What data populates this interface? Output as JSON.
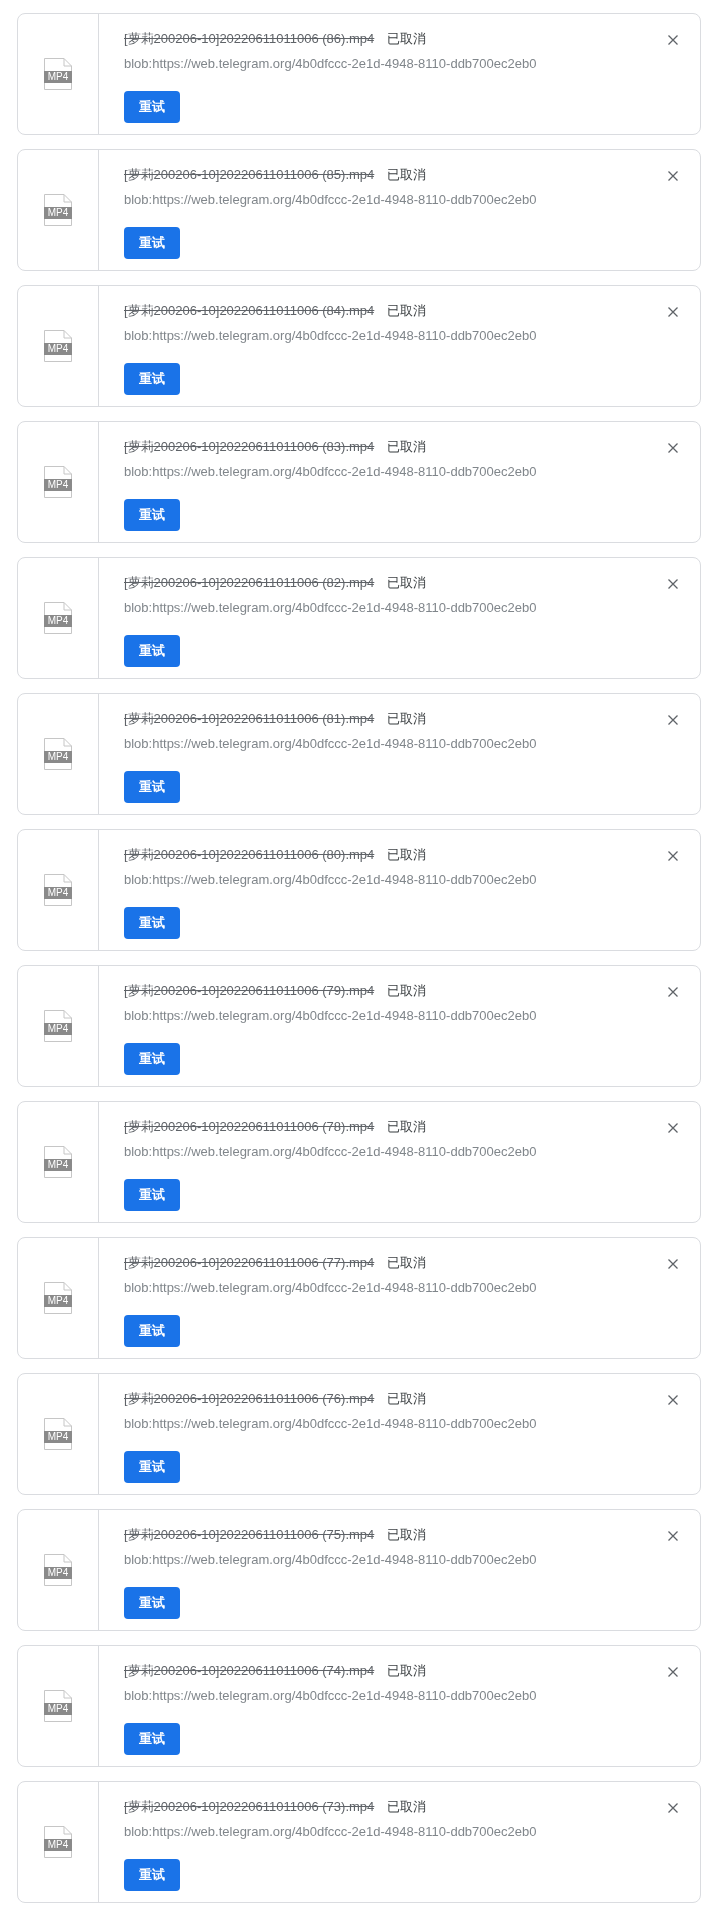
{
  "downloads": [
    {
      "file_type": "MP4",
      "filename": "[萝莉200206-10]20220611011006 (86).mp4",
      "cancelled": true,
      "status": "已取消",
      "url": "blob:https://web.telegram.org/4b0dfccc-2e1d-4948-8110-ddb700ec2eb0",
      "button": "重试"
    },
    {
      "file_type": "MP4",
      "filename": "[萝莉200206-10]20220611011006 (85).mp4",
      "cancelled": true,
      "status": "已取消",
      "url": "blob:https://web.telegram.org/4b0dfccc-2e1d-4948-8110-ddb700ec2eb0",
      "button": "重试"
    },
    {
      "file_type": "MP4",
      "filename": "[萝莉200206-10]20220611011006 (84).mp4",
      "cancelled": true,
      "status": "已取消",
      "url": "blob:https://web.telegram.org/4b0dfccc-2e1d-4948-8110-ddb700ec2eb0",
      "button": "重试"
    },
    {
      "file_type": "MP4",
      "filename": "[萝莉200206-10]20220611011006 (83).mp4",
      "cancelled": true,
      "status": "已取消",
      "url": "blob:https://web.telegram.org/4b0dfccc-2e1d-4948-8110-ddb700ec2eb0",
      "button": "重试"
    },
    {
      "file_type": "MP4",
      "filename": "[萝莉200206-10]20220611011006 (82).mp4",
      "cancelled": true,
      "status": "已取消",
      "url": "blob:https://web.telegram.org/4b0dfccc-2e1d-4948-8110-ddb700ec2eb0",
      "button": "重试"
    },
    {
      "file_type": "MP4",
      "filename": "[萝莉200206-10]20220611011006 (81).mp4",
      "cancelled": true,
      "status": "已取消",
      "url": "blob:https://web.telegram.org/4b0dfccc-2e1d-4948-8110-ddb700ec2eb0",
      "button": "重试"
    },
    {
      "file_type": "MP4",
      "filename": "[萝莉200206-10]20220611011006 (80).mp4",
      "cancelled": true,
      "status": "已取消",
      "url": "blob:https://web.telegram.org/4b0dfccc-2e1d-4948-8110-ddb700ec2eb0",
      "button": "重试"
    },
    {
      "file_type": "MP4",
      "filename": "[萝莉200206-10]20220611011006 (79).mp4",
      "cancelled": true,
      "status": "已取消",
      "url": "blob:https://web.telegram.org/4b0dfccc-2e1d-4948-8110-ddb700ec2eb0",
      "button": "重试"
    },
    {
      "file_type": "MP4",
      "filename": "[萝莉200206-10]20220611011006 (78).mp4",
      "cancelled": true,
      "status": "已取消",
      "url": "blob:https://web.telegram.org/4b0dfccc-2e1d-4948-8110-ddb700ec2eb0",
      "button": "重试"
    },
    {
      "file_type": "MP4",
      "filename": "[萝莉200206-10]20220611011006 (77).mp4",
      "cancelled": true,
      "status": "已取消",
      "url": "blob:https://web.telegram.org/4b0dfccc-2e1d-4948-8110-ddb700ec2eb0",
      "button": "重试"
    },
    {
      "file_type": "MP4",
      "filename": "[萝莉200206-10]20220611011006 (76).mp4",
      "cancelled": true,
      "status": "已取消",
      "url": "blob:https://web.telegram.org/4b0dfccc-2e1d-4948-8110-ddb700ec2eb0",
      "button": "重试"
    },
    {
      "file_type": "MP4",
      "filename": "[萝莉200206-10]20220611011006 (75).mp4",
      "cancelled": true,
      "status": "已取消",
      "url": "blob:https://web.telegram.org/4b0dfccc-2e1d-4948-8110-ddb700ec2eb0",
      "button": "重试"
    },
    {
      "file_type": "MP4",
      "filename": "[萝莉200206-10]20220611011006 (74).mp4",
      "cancelled": true,
      "status": "已取消",
      "url": "blob:https://web.telegram.org/4b0dfccc-2e1d-4948-8110-ddb700ec2eb0",
      "button": "重试"
    },
    {
      "file_type": "MP4",
      "filename": "[萝莉200206-10]20220611011006 (73).mp4",
      "cancelled": true,
      "status": "已取消",
      "url": "blob:https://web.telegram.org/4b0dfccc-2e1d-4948-8110-ddb700ec2eb0",
      "button": "重试"
    }
  ]
}
